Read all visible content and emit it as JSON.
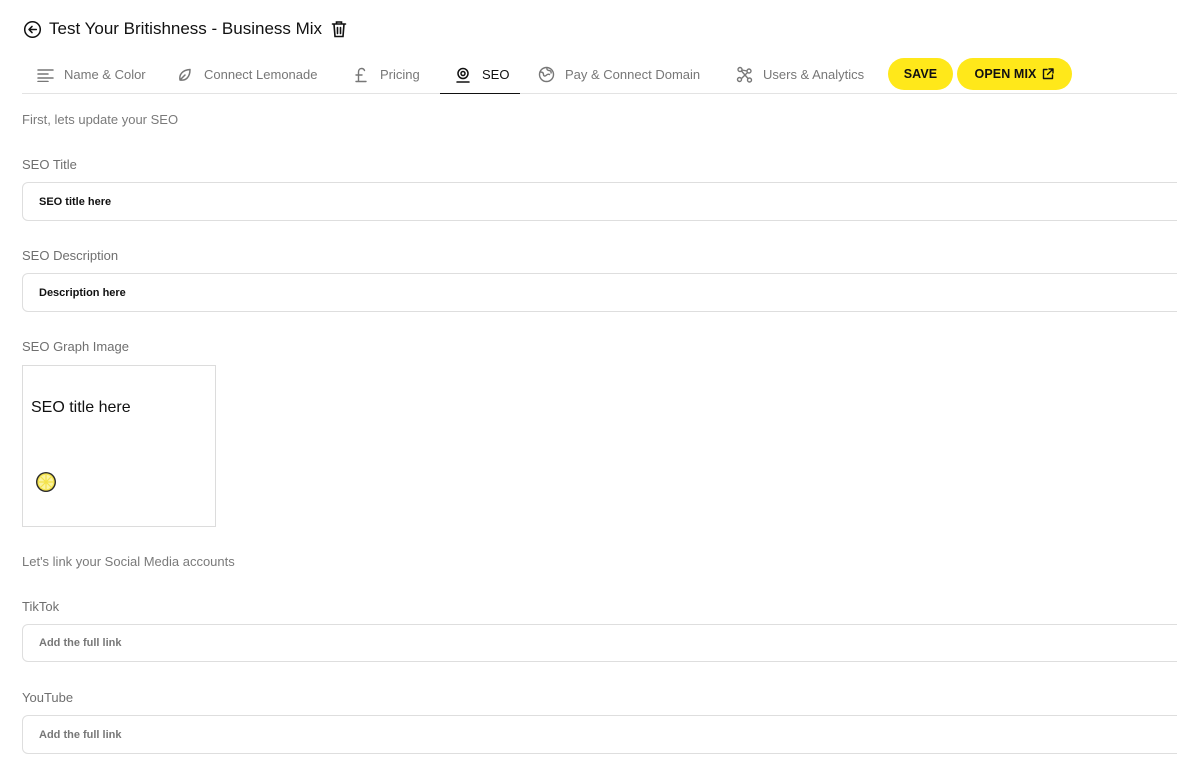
{
  "header": {
    "title": "Test Your Britishness - Business Mix",
    "back_icon": "arrow-left-circle-icon",
    "delete_icon": "trash-icon"
  },
  "tabs": [
    {
      "label": "Name & Color",
      "icon": "align-left-icon",
      "active": false
    },
    {
      "label": "Connect Lemonade",
      "icon": "leaf-icon",
      "active": false
    },
    {
      "label": "Pricing",
      "icon": "pound-icon",
      "active": false
    },
    {
      "label": "SEO",
      "icon": "webcam-icon",
      "active": true
    },
    {
      "label": "Pay & Connect Domain",
      "icon": "globe-icon",
      "active": false
    },
    {
      "label": "Users & Analytics",
      "icon": "network-icon",
      "active": false
    }
  ],
  "actions": {
    "save_label": "SAVE",
    "open_label": "OPEN MIX",
    "open_icon": "external-link-icon",
    "accent_color": "#ffe81a"
  },
  "seo": {
    "intro": "First, lets update your SEO",
    "title_label": "SEO Title",
    "title_value": "SEO title here",
    "description_label": "SEO Description",
    "description_value": "Description here",
    "graph_image_label": "SEO Graph Image",
    "graph_card_title": "SEO title here",
    "graph_card_logo": "lemon-slice-icon"
  },
  "social": {
    "intro": "Let's link your Social Media accounts",
    "tiktok_label": "TikTok",
    "tiktok_placeholder": "Add the full link",
    "youtube_label": "YouTube",
    "youtube_placeholder": "Add the full link"
  }
}
